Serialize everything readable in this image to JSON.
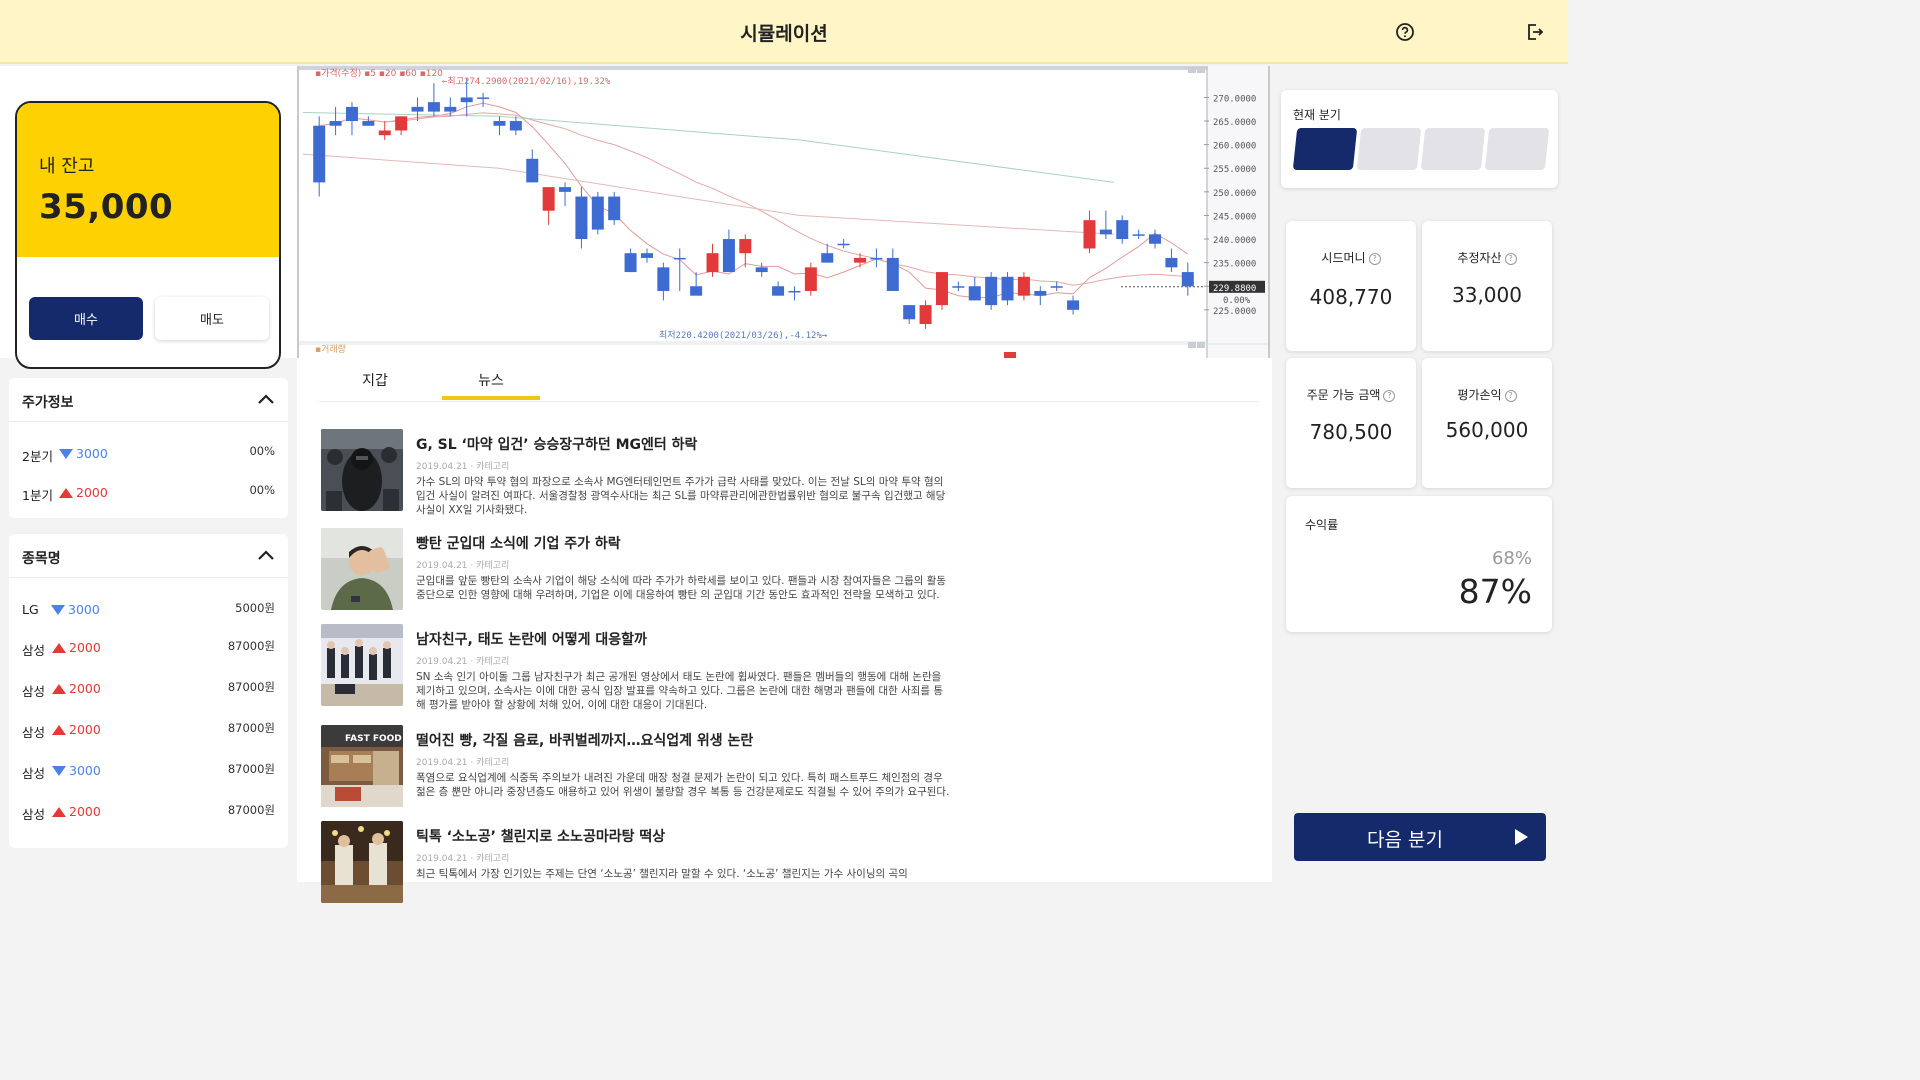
{
  "header": {
    "title": "시뮬레이션",
    "help_icon": "help-circle-icon",
    "logout_icon": "logout-icon"
  },
  "balance": {
    "label": "내 잔고",
    "amount": "35,000",
    "buy_label": "매수",
    "sell_label": "매도"
  },
  "price_info": {
    "title": "주가정보",
    "rows": [
      {
        "name": "2분기",
        "direction": "down",
        "change": "3000",
        "rate": "00%"
      },
      {
        "name": "1분기",
        "direction": "up",
        "change": "2000",
        "rate": "00%"
      }
    ]
  },
  "stocks": {
    "title": "종목명",
    "rows": [
      {
        "name": "LG",
        "direction": "down",
        "change": "3000",
        "price": "5000원"
      },
      {
        "name": "삼성",
        "direction": "up",
        "change": "2000",
        "price": "87000원"
      },
      {
        "name": "삼성",
        "direction": "up",
        "change": "2000",
        "price": "87000원"
      },
      {
        "name": "삼성",
        "direction": "up",
        "change": "2000",
        "price": "87000원"
      },
      {
        "name": "삼성",
        "direction": "down",
        "change": "3000",
        "price": "87000원"
      },
      {
        "name": "삼성",
        "direction": "up",
        "change": "2000",
        "price": "87000원"
      }
    ]
  },
  "chart": {
    "legend": "▪가격(수정) ▪5 ▪20 ▪60 ▪120",
    "max_label": "←최고274.2900(2021/02/16),19.32%",
    "min_label": "최저220.4200(2021/03/26),-4.12%→",
    "volume_label": "▪거래량",
    "current_price": "229.8800",
    "current_pct": "0.00%"
  },
  "chart_data": {
    "type": "candlestick",
    "y_ticks": [
      "270.0000",
      "265.0000",
      "260.0000",
      "255.0000",
      "250.0000",
      "245.0000",
      "240.0000",
      "235.0000",
      "230.0000",
      "225.0000"
    ],
    "ylim": [
      222,
      272
    ],
    "candles": [
      {
        "o": 252,
        "h": 266,
        "l": 249,
        "c": 264,
        "color": "blue"
      },
      {
        "o": 264,
        "h": 268,
        "l": 262,
        "c": 265,
        "color": "blue"
      },
      {
        "o": 265,
        "h": 269,
        "l": 262,
        "c": 268,
        "color": "blue"
      },
      {
        "o": 265,
        "h": 266,
        "l": 264,
        "c": 264,
        "color": "blue"
      },
      {
        "o": 262,
        "h": 265,
        "l": 261,
        "c": 263,
        "color": "red"
      },
      {
        "o": 263,
        "h": 266,
        "l": 262,
        "c": 266,
        "color": "red"
      },
      {
        "o": 267,
        "h": 270,
        "l": 265,
        "c": 268,
        "color": "blue"
      },
      {
        "o": 267,
        "h": 273,
        "l": 266,
        "c": 269,
        "color": "blue"
      },
      {
        "o": 268,
        "h": 270,
        "l": 266,
        "c": 267,
        "color": "blue"
      },
      {
        "o": 269,
        "h": 274,
        "l": 266,
        "c": 270,
        "color": "blue"
      },
      {
        "o": 270,
        "h": 271,
        "l": 268,
        "c": 270,
        "color": "blue"
      },
      {
        "o": 265,
        "h": 266,
        "l": 262,
        "c": 264,
        "color": "blue"
      },
      {
        "o": 265,
        "h": 266,
        "l": 262,
        "c": 263,
        "color": "blue"
      },
      {
        "o": 257,
        "h": 259,
        "l": 252,
        "c": 252,
        "color": "blue"
      },
      {
        "o": 246,
        "h": 251,
        "l": 243,
        "c": 251,
        "color": "red"
      },
      {
        "o": 251,
        "h": 252,
        "l": 247,
        "c": 250,
        "color": "blue"
      },
      {
        "o": 249,
        "h": 251,
        "l": 238,
        "c": 240,
        "color": "blue"
      },
      {
        "o": 249,
        "h": 250,
        "l": 241,
        "c": 242,
        "color": "blue"
      },
      {
        "o": 249,
        "h": 250,
        "l": 243,
        "c": 244,
        "color": "blue"
      },
      {
        "o": 237,
        "h": 238,
        "l": 233,
        "c": 233,
        "color": "blue"
      },
      {
        "o": 237,
        "h": 238,
        "l": 235,
        "c": 236,
        "color": "blue"
      },
      {
        "o": 234,
        "h": 235,
        "l": 227,
        "c": 229,
        "color": "blue"
      },
      {
        "o": 236,
        "h": 238,
        "l": 229,
        "c": 236,
        "color": "blue"
      },
      {
        "o": 230,
        "h": 233,
        "l": 229,
        "c": 228,
        "color": "blue"
      },
      {
        "o": 233,
        "h": 239,
        "l": 232,
        "c": 237,
        "color": "red"
      },
      {
        "o": 240,
        "h": 242,
        "l": 233,
        "c": 233,
        "color": "blue"
      },
      {
        "o": 237,
        "h": 241,
        "l": 234,
        "c": 240,
        "color": "red"
      },
      {
        "o": 234,
        "h": 235,
        "l": 232,
        "c": 233,
        "color": "blue"
      },
      {
        "o": 230,
        "h": 231,
        "l": 228,
        "c": 228,
        "color": "blue"
      },
      {
        "o": 229,
        "h": 230,
        "l": 227,
        "c": 229,
        "color": "blue"
      },
      {
        "o": 229,
        "h": 235,
        "l": 228,
        "c": 234,
        "color": "red"
      },
      {
        "o": 237,
        "h": 239,
        "l": 235,
        "c": 235,
        "color": "blue"
      },
      {
        "o": 239,
        "h": 240,
        "l": 238,
        "c": 239,
        "color": "blue"
      },
      {
        "o": 236,
        "h": 237,
        "l": 234,
        "c": 235,
        "color": "red"
      },
      {
        "o": 236,
        "h": 238,
        "l": 234,
        "c": 236,
        "color": "blue"
      },
      {
        "o": 236,
        "h": 238,
        "l": 229,
        "c": 229,
        "color": "blue"
      },
      {
        "o": 223,
        "h": 226,
        "l": 222,
        "c": 226,
        "color": "blue"
      },
      {
        "o": 226,
        "h": 227,
        "l": 221,
        "c": 222,
        "color": "red"
      },
      {
        "o": 226,
        "h": 233,
        "l": 225,
        "c": 233,
        "color": "red"
      },
      {
        "o": 230,
        "h": 231,
        "l": 229,
        "c": 230,
        "color": "blue"
      },
      {
        "o": 230,
        "h": 232,
        "l": 227,
        "c": 227,
        "color": "blue"
      },
      {
        "o": 232,
        "h": 233,
        "l": 225,
        "c": 226,
        "color": "blue"
      },
      {
        "o": 232,
        "h": 233,
        "l": 226,
        "c": 227,
        "color": "blue"
      },
      {
        "o": 228,
        "h": 233,
        "l": 227,
        "c": 232,
        "color": "red"
      },
      {
        "o": 229,
        "h": 230,
        "l": 226,
        "c": 228,
        "color": "blue"
      },
      {
        "o": 230,
        "h": 231,
        "l": 229,
        "c": 230,
        "color": "blue"
      },
      {
        "o": 227,
        "h": 228,
        "l": 224,
        "c": 225,
        "color": "blue"
      },
      {
        "o": 238,
        "h": 246,
        "l": 237,
        "c": 244,
        "color": "red"
      },
      {
        "o": 241,
        "h": 246,
        "l": 240,
        "c": 242,
        "color": "blue"
      },
      {
        "o": 244,
        "h": 245,
        "l": 239,
        "c": 240,
        "color": "blue"
      },
      {
        "o": 241,
        "h": 242,
        "l": 240,
        "c": 241,
        "color": "blue"
      },
      {
        "o": 241,
        "h": 242,
        "l": 238,
        "c": 239,
        "color": "blue"
      },
      {
        "o": 236,
        "h": 238,
        "l": 233,
        "c": 234,
        "color": "blue"
      },
      {
        "o": 233,
        "h": 235,
        "l": 228,
        "c": 230,
        "color": "blue"
      }
    ]
  },
  "tabs": [
    {
      "label": "지갑"
    },
    {
      "label": "뉴스"
    }
  ],
  "news": [
    {
      "headline": "G, SL ‘마약 입건’ 승승장구하던  MG엔터 하락",
      "meta": "2019.04.21 · 카테고리",
      "body": "가수 SL의 마약 투약 혐의 파장으로 소속사 MG엔터테인먼트 주가가 급락 사태를 맞았다. 이는 전날 SL의 마약 투약 혐의 입건 사실이 알려진 여파다. 서울경찰청 광역수사대는 최근 SL를 마약류관리에관한법률위반 혐의로 불구속 입건했고 해당 사실이 XX일 기사화됐다."
    },
    {
      "headline": "빵탄 군입대 소식에 기업 주가 하락",
      "meta": "2019.04.21 · 카테고리",
      "body": "군입대를 앞둔 빵탄의 소속사 기업이 해당 소식에 따라 주가가 하락세를 보이고 있다. 팬들과 시장 참여자들은 그룹의 활동 중단으로 인한 영향에 대해 우려하며, 기업은 이에 대응하여 빵탄 의 군입대 기간 동안도 효과적인 전략을 모색하고 있다."
    },
    {
      "headline": "남자친구, 태도 논란에 어떻게 대응할까",
      "meta": "2019.04.21 · 카테고리",
      "body": "SN 소속 인기 아이돌 그룹 남자친구가 최근 공개된 영상에서 태도 논란에 휩싸였다. 팬들은 멤버들의 행동에 대해 논란을 제기하고 있으며, 소속사는 이에 대한 공식 입장 발표를 약속하고 있다. 그룹은 논란에 대한 해명과 팬들에 대한 사죄를 통해 평가를 받아야 할 상황에 처해 있어, 이에 대한 대응이 기대된다."
    },
    {
      "headline": "떨어진 빵, 각질 음료, 바퀴벌레까지…요식업계 위생 논란",
      "meta": "2019.04.21 · 카테고리",
      "body": "폭염으로 요식업계에 식중독 주의보가 내려진 가운데 매장 청결 문제가 논란이 되고 있다. 특히 패스트푸드 체인점의 경우 젊은 층 뿐만 아니라 중장년층도 애용하고 있어 위생이 불량할 경우 복통 등 건강문제로도 직결될 수 있어 주의가 요구된다.",
      "sign": "FAST FOOD"
    },
    {
      "headline": "틱톡 ‘소노공’ 챌린지로 소노공마라탕 떡상",
      "meta": "2019.04.21 · 카테고리",
      "body": "최근 틱톡에서 가장 인기있는 주제는 단연 ‘소노공’ 챌린지라 말할 수 있다. ‘소노공’ 챌린지는 가수 사이닝의 곡의"
    }
  ],
  "quarter": {
    "label": "현재 분기",
    "total": 4,
    "current": 1,
    "active_color": "#142a6b",
    "inactive_color": "#e3e2e7"
  },
  "stats": [
    {
      "label": "시드머니",
      "value": "408,770"
    },
    {
      "label": "추정자산",
      "value": "33,000"
    },
    {
      "label": "주문 가능 금액",
      "value": "780,500"
    },
    {
      "label": "평가손익",
      "value": "560,000"
    }
  ],
  "yield": {
    "label": "수익률",
    "prev": "68%",
    "current": "87%"
  },
  "next_button": {
    "label": "다음 분기"
  },
  "colors": {
    "accent_yellow": "#fed103",
    "navy": "#142a6b",
    "up": "#e53935",
    "down": "#4c82e8",
    "header_bg": "#fff5c6"
  }
}
